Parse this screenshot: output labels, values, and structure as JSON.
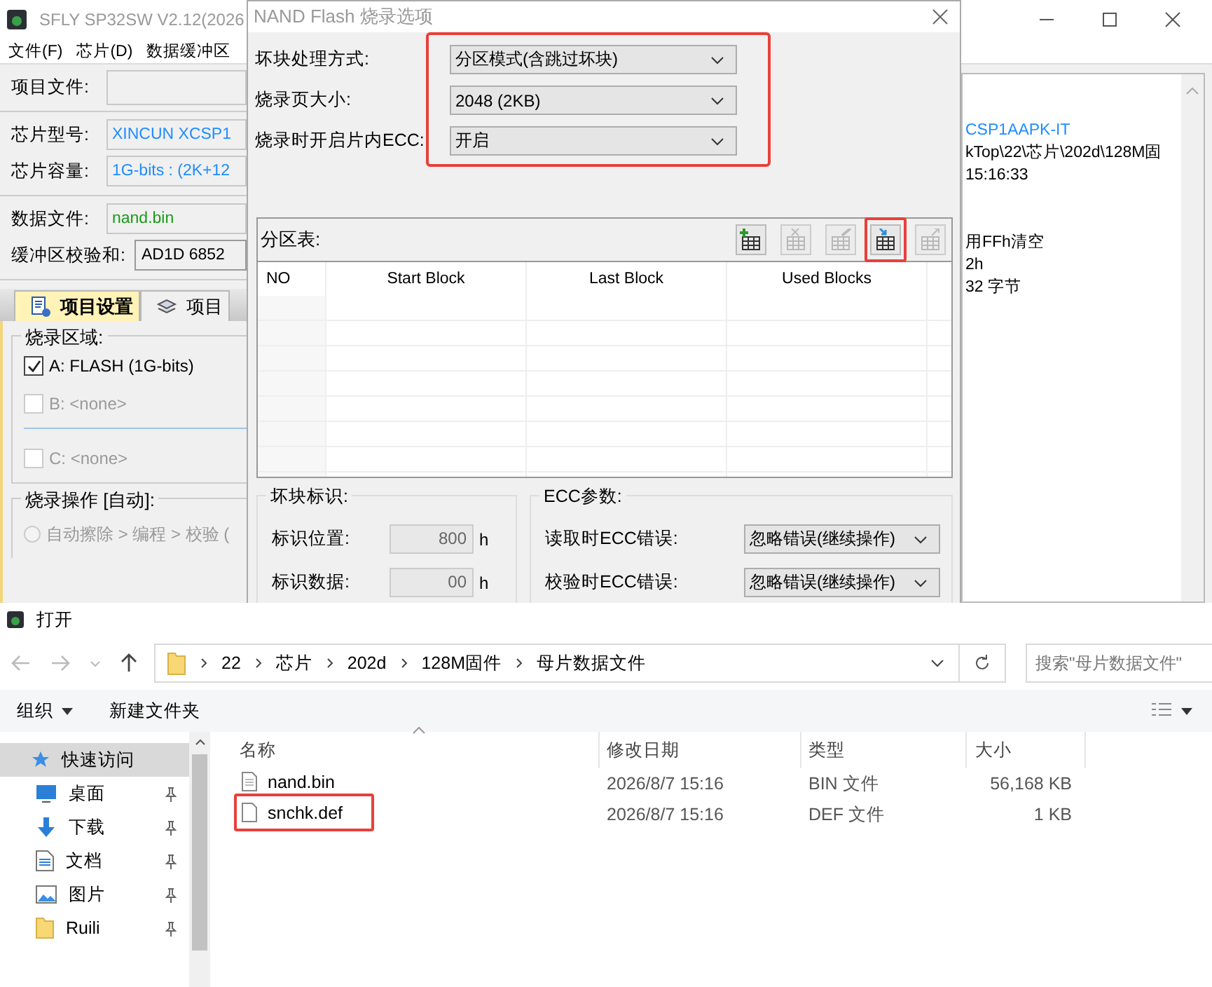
{
  "main_window": {
    "title": "SFLY SP32SW V2.12(2026",
    "menu": [
      "文件(F)",
      "芯片(D)",
      "数据缓冲区"
    ],
    "project_file": {
      "label": "项目文件:"
    },
    "chip_fields": [
      {
        "label": "芯片型号:",
        "value": "XINCUN XCSP1",
        "color": "#1e8cff"
      },
      {
        "label": "芯片容量:",
        "value": "1G-bits : (2K+12",
        "color": "#1e8cff"
      }
    ],
    "data_file": {
      "label": "数据文件:",
      "value": "nand.bin",
      "color": "#1a9a1a"
    },
    "checksum": {
      "label": "缓冲区校验和:",
      "value": "AD1D 6852"
    },
    "tabs": [
      {
        "label": "项目设置",
        "selected": true
      },
      {
        "label": "项目",
        "selected": false
      }
    ],
    "burn_area": {
      "title": "烧录区域:",
      "items": [
        {
          "label": "A: FLASH (1G-bits)",
          "checked": true,
          "disabled": false
        },
        {
          "label": "B: <none>",
          "checked": false,
          "disabled": true
        },
        {
          "label": "C: <none>",
          "checked": false,
          "disabled": true
        }
      ]
    },
    "burn_ops": {
      "title": "烧录操作 [自动]:",
      "options": [
        {
          "label": "自动擦除 > 编程 > 校验 (",
          "selected": false,
          "disabled": true
        }
      ]
    },
    "log_blocks": [
      {
        "lines": [
          {
            "text": "CSP1AAPK-IT",
            "color": "#1e8cff"
          },
          {
            "text": "kTop\\22\\芯片\\202d\\128M固",
            "color": "#000000"
          },
          {
            "text": "15:16:33",
            "color": "#000000"
          }
        ]
      },
      {
        "lines": [
          {
            "text": "用FFh清空",
            "color": "#000000"
          },
          {
            "text": "2h",
            "color": "#000000"
          },
          {
            "text": "32 字节",
            "color": "#000000"
          }
        ]
      }
    ]
  },
  "dialog": {
    "title": "NAND Flash 烧录选项",
    "options_highlighted": true,
    "options": [
      {
        "label": "坏块处理方式:",
        "value": "分区模式(含跳过坏块)"
      },
      {
        "label": "烧录页大小:",
        "value": "2048 (2KB)"
      },
      {
        "label": "烧录时开启片内ECC:",
        "value": "开启"
      }
    ],
    "partition": {
      "title": "分区表:",
      "toolbar": [
        {
          "kind": "add",
          "enabled": true,
          "highlighted": false
        },
        {
          "kind": "delete",
          "enabled": false,
          "highlighted": false
        },
        {
          "kind": "edit",
          "enabled": false,
          "highlighted": false
        },
        {
          "kind": "import",
          "enabled": true,
          "highlighted": true
        },
        {
          "kind": "export",
          "enabled": false,
          "highlighted": false
        }
      ],
      "columns": [
        "NO",
        "Start Block",
        "Last Block",
        "Used Blocks"
      ]
    },
    "bad_block": {
      "title": "坏块标识:",
      "fields": [
        {
          "label": "标识位置:",
          "value": "800",
          "unit": "h",
          "disabled": true
        },
        {
          "label": "标识数据:",
          "value": "00",
          "unit": "h",
          "disabled": true
        }
      ]
    },
    "ecc": {
      "title": "ECC参数:",
      "fields": [
        {
          "label": "读取时ECC错误:",
          "value": "忽略错误(继续操作)"
        },
        {
          "label": "校验时ECC错误:",
          "value": "忽略错误(继续操作)"
        }
      ]
    }
  },
  "open_dialog": {
    "title": "打开",
    "breadcrumb": [
      "22",
      "芯片",
      "202d",
      "128M固件",
      "母片数据文件"
    ],
    "search": {
      "placeholder": "搜索\"母片数据文件\""
    },
    "toolbar": [
      {
        "label": "组织",
        "dropdown": true
      },
      {
        "label": "新建文件夹",
        "dropdown": false
      }
    ],
    "sidebar": [
      {
        "label": "快速访问",
        "kind": "star",
        "pinned": false,
        "selected": true
      },
      {
        "label": "桌面",
        "kind": "desktop",
        "pinned": true,
        "selected": false
      },
      {
        "label": "下载",
        "kind": "download",
        "pinned": true,
        "selected": false
      },
      {
        "label": "文档",
        "kind": "document",
        "pinned": true,
        "selected": false
      },
      {
        "label": "图片",
        "kind": "picture",
        "pinned": true,
        "selected": false
      },
      {
        "label": "Ruili",
        "kind": "folder",
        "pinned": true,
        "selected": false
      }
    ],
    "columns": [
      "名称",
      "修改日期",
      "类型",
      "大小"
    ],
    "files": [
      {
        "name": "nand.bin",
        "date": "2026/8/7 15:16",
        "type": "BIN 文件",
        "size": "56,168 KB",
        "highlighted": false
      },
      {
        "name": "snchk.def",
        "date": "2026/8/7 15:16",
        "type": "DEF 文件",
        "size": "1 KB",
        "highlighted": true
      }
    ]
  }
}
